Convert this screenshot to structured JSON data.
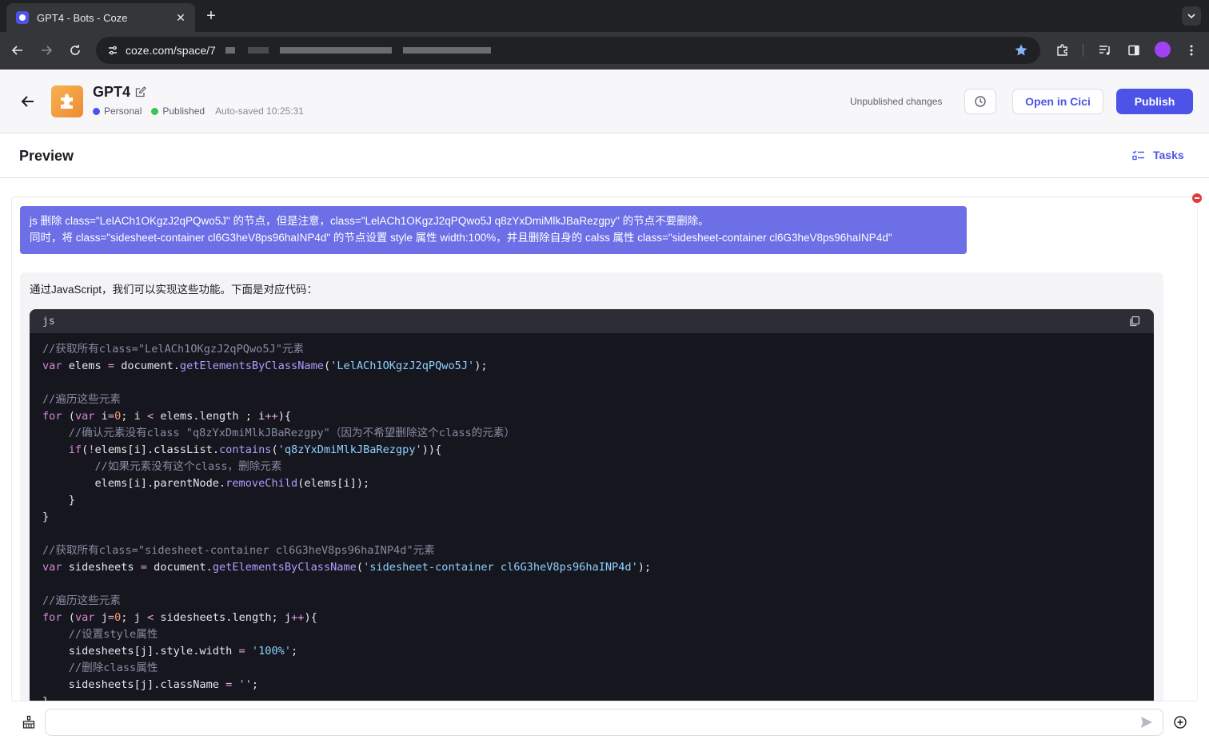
{
  "browser": {
    "tab_title": "GPT4 - Bots - Coze",
    "url": "coze.com/space/7"
  },
  "header": {
    "bot_name": "GPT4",
    "workspace": "Personal",
    "status": "Published",
    "autosave": "Auto-saved 10:25:31",
    "unpublished": "Unpublished changes",
    "open_label": "Open in Cici",
    "publish_label": "Publish"
  },
  "preview": {
    "title": "Preview",
    "tasks_label": "Tasks"
  },
  "colors": {
    "accent": "#4d53e8",
    "user_bubble": "#6c6fe6",
    "code_bg": "#15161e",
    "published_green": "#3ec254"
  },
  "chat": {
    "user_message": {
      "line1": "js 删除 class=\"LelACh1OKgzJ2qPQwo5J\" 的节点，但是注意，class=\"LelACh1OKgzJ2qPQwo5J q8zYxDmiMlkJBaRezgpy\" 的节点不要删除。",
      "line2": "同时，将 class=\"sidesheet-container cl6G3heV8ps96haINP4d\" 的节点设置 style 属性 width:100%，并且删除自身的 calss 属性 class=\"sidesheet-container cl6G3heV8ps96haINP4d\""
    },
    "bot_message": {
      "intro": "通过JavaScript，我们可以实现这些功能。下面是对应代码：",
      "code_language": "js"
    },
    "input_placeholder": ""
  },
  "icons": {
    "back": "arrow-left-icon",
    "edit": "edit-icon",
    "history": "history-icon",
    "tasks": "tasks-icon",
    "copy": "copy-icon",
    "broom": "broom-icon",
    "send": "send-icon",
    "add": "plus-circle-icon"
  }
}
